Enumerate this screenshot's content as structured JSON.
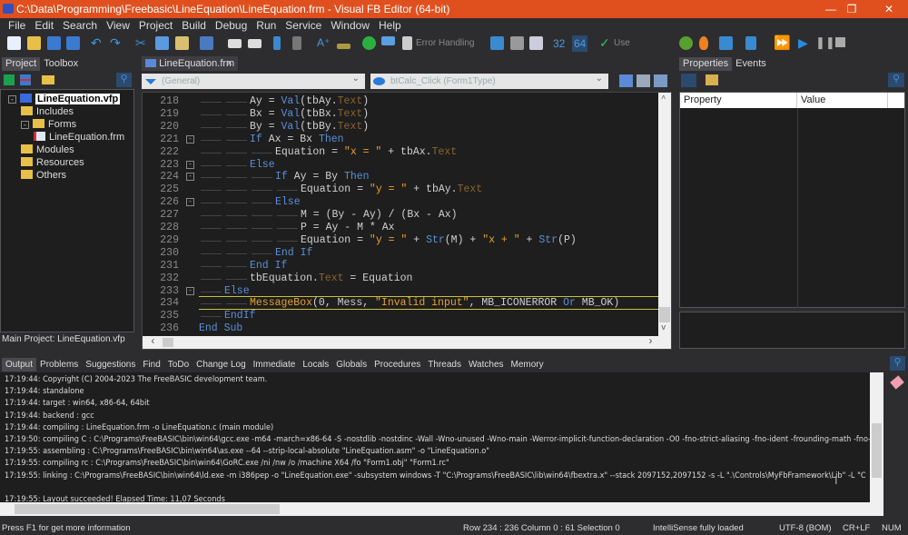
{
  "window": {
    "title": "C:\\Data\\Programming\\Freebasic\\LineEquation\\LineEquation.frm - Visual FB Editor (64-bit)",
    "minimize": "—",
    "maximize": "❐",
    "close": "✕"
  },
  "menu": [
    "File",
    "Edit",
    "Search",
    "View",
    "Project",
    "Build",
    "Debug",
    "Run",
    "Service",
    "Window",
    "Help"
  ],
  "toolbar": {
    "error_handling": "Error Handling",
    "bits32": "32",
    "bits64": "64",
    "use": "Use"
  },
  "left_panel": {
    "tabs": [
      "Project",
      "Toolbox"
    ],
    "tree": [
      {
        "label": "LineEquation.vfp",
        "level": 0,
        "type": "project"
      },
      {
        "label": "Includes",
        "level": 1,
        "type": "folder"
      },
      {
        "label": "Forms",
        "level": 1,
        "type": "folder"
      },
      {
        "label": "LineEquation.frm",
        "level": 2,
        "type": "form"
      },
      {
        "label": "Modules",
        "level": 1,
        "type": "folder"
      },
      {
        "label": "Resources",
        "level": 1,
        "type": "folder"
      },
      {
        "label": "Others",
        "level": 1,
        "type": "folder"
      }
    ],
    "main_project": "Main Project: LineEquation.vfp"
  },
  "editor": {
    "tab": "LineEquation.frm",
    "tab_close": "×",
    "combo_object": "(General)",
    "combo_proc": "btCalc_Click (Form1Type)",
    "lines": [
      {
        "n": "218",
        "lvl": 2,
        "t": [
          [
            "",
            "Ay = "
          ],
          [
            "fn",
            "Val"
          ],
          [
            "",
            "(tbAy."
          ],
          [
            "pr",
            "Text"
          ],
          [
            "",
            ")"
          ]
        ]
      },
      {
        "n": "219",
        "lvl": 2,
        "t": [
          [
            "",
            "Bx = "
          ],
          [
            "fn",
            "Val"
          ],
          [
            "",
            "(tbBx."
          ],
          [
            "pr",
            "Text"
          ],
          [
            "",
            ")"
          ]
        ]
      },
      {
        "n": "220",
        "lvl": 2,
        "t": [
          [
            "",
            "By = "
          ],
          [
            "fn",
            "Val"
          ],
          [
            "",
            "(tbBy."
          ],
          [
            "pr",
            "Text"
          ],
          [
            "",
            ")"
          ]
        ]
      },
      {
        "n": "221",
        "lvl": 2,
        "fold": "-",
        "t": [
          [
            "kw",
            "If"
          ],
          [
            "",
            " Ax = Bx "
          ],
          [
            "kw",
            "Then"
          ]
        ]
      },
      {
        "n": "222",
        "lvl": 3,
        "t": [
          [
            "",
            "Equation = "
          ],
          [
            "st",
            "\"x = \""
          ],
          [
            "",
            " + tbAx."
          ],
          [
            "pr",
            "Text"
          ]
        ]
      },
      {
        "n": "223",
        "lvl": 2,
        "fold": "-",
        "t": [
          [
            "kw",
            "Else"
          ]
        ]
      },
      {
        "n": "224",
        "lvl": 3,
        "fold": "-",
        "t": [
          [
            "kw",
            "If"
          ],
          [
            "",
            " Ay = By "
          ],
          [
            "kw",
            "Then"
          ]
        ]
      },
      {
        "n": "225",
        "lvl": 4,
        "t": [
          [
            "",
            "Equation = "
          ],
          [
            "st",
            "\"y = \""
          ],
          [
            "",
            " + tbAy."
          ],
          [
            "pr",
            "Text"
          ]
        ]
      },
      {
        "n": "226",
        "lvl": 3,
        "fold": "-",
        "t": [
          [
            "kw",
            "Else"
          ]
        ]
      },
      {
        "n": "227",
        "lvl": 4,
        "t": [
          [
            "",
            "M = (By - Ay) / (Bx - Ax)"
          ]
        ]
      },
      {
        "n": "228",
        "lvl": 4,
        "t": [
          [
            "",
            "P = Ay - M * Ax"
          ]
        ]
      },
      {
        "n": "229",
        "lvl": 4,
        "t": [
          [
            "",
            "Equation = "
          ],
          [
            "st",
            "\"y = \""
          ],
          [
            "",
            " + "
          ],
          [
            "fn",
            "Str"
          ],
          [
            "",
            "(M) + "
          ],
          [
            "st",
            "\"x + \""
          ],
          [
            "",
            " + "
          ],
          [
            "fn",
            "Str"
          ],
          [
            "",
            "(P)"
          ]
        ]
      },
      {
        "n": "230",
        "lvl": 3,
        "t": [
          [
            "kw",
            "End If"
          ]
        ]
      },
      {
        "n": "231",
        "lvl": 2,
        "t": [
          [
            "kw",
            "End If"
          ]
        ]
      },
      {
        "n": "232",
        "lvl": 2,
        "t": [
          [
            "",
            "tbEquation."
          ],
          [
            "pr",
            "Text"
          ],
          [
            "",
            " = Equation"
          ]
        ]
      },
      {
        "n": "233",
        "lvl": 1,
        "fold": "-",
        "t": [
          [
            "kw",
            "Else"
          ]
        ]
      },
      {
        "n": "234",
        "lvl": 2,
        "current": true,
        "t": [
          [
            "st",
            "MessageBox"
          ],
          [
            "",
            "(0, Mess, "
          ],
          [
            "st",
            "\"Invalid input\""
          ],
          [
            "",
            ", MB_ICONERROR "
          ],
          [
            "kw",
            "Or"
          ],
          [
            "",
            " MB_OK)"
          ]
        ]
      },
      {
        "n": "235",
        "lvl": 1,
        "t": [
          [
            "kw",
            "EndIf"
          ]
        ]
      },
      {
        "n": "236",
        "lvl": 0,
        "t": [
          [
            "kw",
            "End Sub"
          ]
        ]
      }
    ]
  },
  "right_panel": {
    "tabs": [
      "Properties",
      "Events"
    ],
    "columns": [
      "Property",
      "Value"
    ]
  },
  "bottom": {
    "tabs": [
      "Output",
      "Problems",
      "Suggestions",
      "Find",
      "ToDo",
      "Change Log",
      "Immediate",
      "Locals",
      "Globals",
      "Procedures",
      "Threads",
      "Watches",
      "Memory"
    ],
    "output": [
      "17:19:44: Copyright (C) 2004-2023 The FreeBASIC development team.",
      "17:19:44: standalone",
      "17:19:44: target :       win64, x86-64, 64bit",
      "17:19:44: backend :       gcc",
      "17:19:44: compiling :    LineEquation.frm -o LineEquation.c (main module)",
      "17:19:50: compiling C :   C:\\Programs\\FreeBASIC\\bin\\win64\\gcc.exe -m64 -march=x86-64 -S -nostdlib -nostdinc -Wall -Wno-unused -Wno-main -Werror-implicit-function-declaration -O0 -fno-strict-aliasing -fno-ident -frounding-math -fno-r",
      "17:19:55: assembling :   C:\\Programs\\FreeBASIC\\bin\\win64\\as.exe --64 --strip-local-absolute \"LineEquation.asm\" -o \"LineEquation.o\"",
      "17:19:55: compiling rc :              C:\\Programs\\FreeBASIC\\bin\\win64\\GoRC.exe /ni /nw /o /machine X64 /fo \"Form1.obj\" \"Form1.rc\"",
      "17:19:55: linking :       C:\\Programs\\FreeBASIC\\bin\\win64\\ld.exe -m i386pep -o \"LineEquation.exe\" -subsystem windows -T \"C:\\Programs\\FreeBASIC\\lib\\win64\\fbextra.x\" --stack 2097152,2097152 -s -L \".\\Controls\\MyFbFramework\\Lib\" -L \"C",
      "",
      "17:19:55: Layout succeeded! Elapsed Time: 11,07 Seconds"
    ]
  },
  "status": {
    "hint": "Press F1 for get more information",
    "position": "Row 234 : 236  Column 0 : 61  Selection 0",
    "intellisense": "IntelliSense fully loaded",
    "encoding": "UTF-8 (BOM)",
    "eol": "CR+LF",
    "num": "NUM"
  },
  "colors": {
    "titlebar": "#e0501e",
    "keyword": "#5a8fd8",
    "string": "#e8a030",
    "property": "#8a6330",
    "background": "#1e1e1e"
  }
}
